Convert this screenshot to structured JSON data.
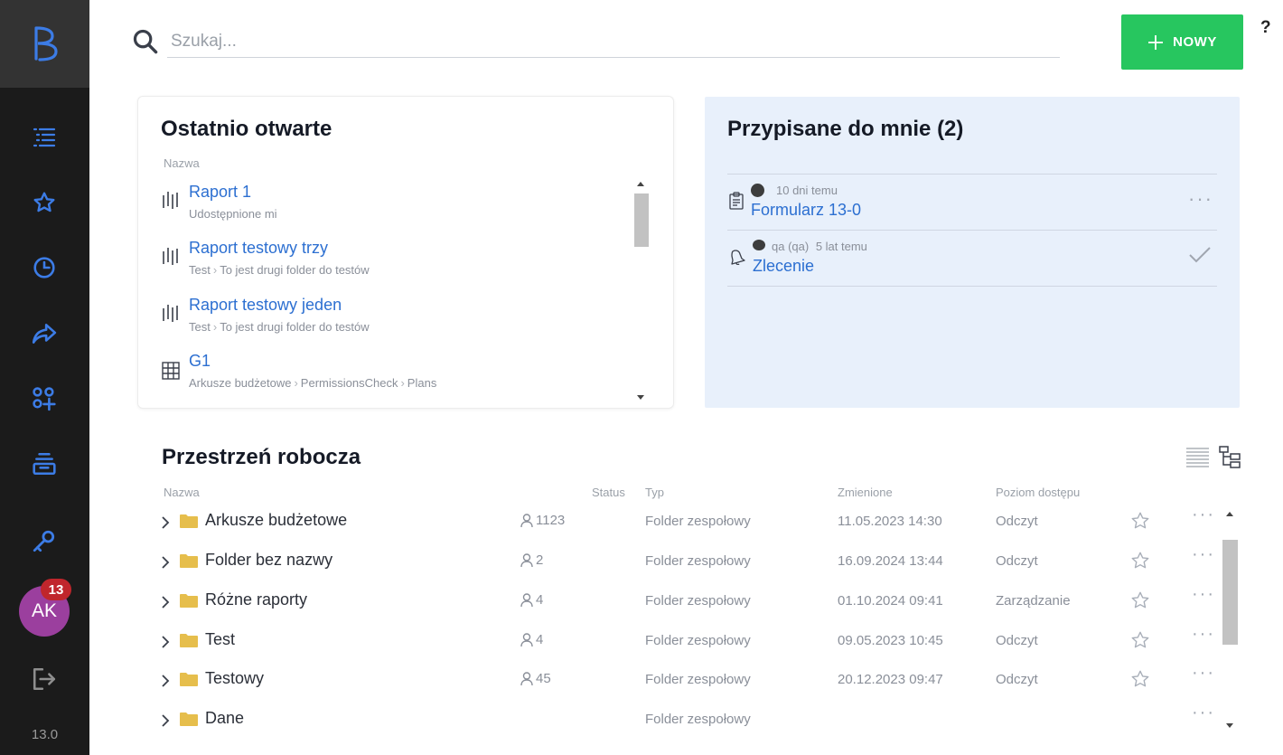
{
  "sidebar": {
    "logo": "B",
    "items": [
      {
        "icon": "list-icon"
      },
      {
        "icon": "star-icon"
      },
      {
        "icon": "clock-icon"
      },
      {
        "icon": "share-icon"
      },
      {
        "icon": "apps-add-icon"
      },
      {
        "icon": "inbox-stack-icon"
      },
      {
        "icon": "key-icon"
      }
    ],
    "avatar_initials": "AK",
    "notification_count": "13",
    "logout_icon": "logout-icon",
    "version": "13.0",
    "accent_color": "#3c7ce6"
  },
  "topbar": {
    "search_placeholder": "Szukaj...",
    "new_button_label": "NOWY",
    "help_label": "?"
  },
  "recent": {
    "title": "Ostatnio otwarte",
    "column_label": "Nazwa",
    "items": [
      {
        "name": "Raport 1",
        "path": [
          "Udostępnione mi"
        ],
        "icon": "report-icon"
      },
      {
        "name": "Raport testowy trzy",
        "path": [
          "Test",
          "To jest drugi folder do testów"
        ],
        "icon": "report-icon"
      },
      {
        "name": "Raport testowy jeden",
        "path": [
          "Test",
          "To jest drugi folder do testów"
        ],
        "icon": "report-icon"
      },
      {
        "name": "G1",
        "path": [
          "Arkusze budżetowe",
          "PermissionsCheck",
          "Plans"
        ],
        "icon": "grid-sheet-icon"
      }
    ]
  },
  "assigned": {
    "title": "Przypisane do mnie (2)",
    "items": [
      {
        "meta": "10 dni temu",
        "user": "",
        "name": "Formularz 13-0",
        "icon": "clipboard-icon",
        "action": "more-icon"
      },
      {
        "meta": "5 lat temu",
        "user": "qa (qa)",
        "name": "Zlecenie",
        "icon": "bell-icon",
        "action": "check-icon"
      }
    ]
  },
  "workspace": {
    "title": "Przestrzeń robocza",
    "columns": {
      "name": "Nazwa",
      "status": "Status",
      "type": "Typ",
      "changed": "Zmienione",
      "access": "Poziom dostępu"
    },
    "rows": [
      {
        "name": "Arkusze budżetowe",
        "members": "1123",
        "type": "Folder zespołowy",
        "changed": "11.05.2023 14:30",
        "access": "Odczyt"
      },
      {
        "name": "Folder bez nazwy",
        "members": "2",
        "type": "Folder zespołowy",
        "changed": "16.09.2024 13:44",
        "access": "Odczyt"
      },
      {
        "name": "Różne raporty",
        "members": "4",
        "type": "Folder zespołowy",
        "changed": "01.10.2024 09:41",
        "access": "Zarządzanie"
      },
      {
        "name": "Test",
        "members": "4",
        "type": "Folder zespołowy",
        "changed": "09.05.2023 10:45",
        "access": "Odczyt"
      },
      {
        "name": "Testowy",
        "members": "45",
        "type": "Folder zespołowy",
        "changed": "20.12.2023 09:47",
        "access": "Odczyt"
      },
      {
        "name": "Dane",
        "members": "",
        "type": "Folder zespołowy",
        "changed": "",
        "access": ""
      }
    ]
  }
}
